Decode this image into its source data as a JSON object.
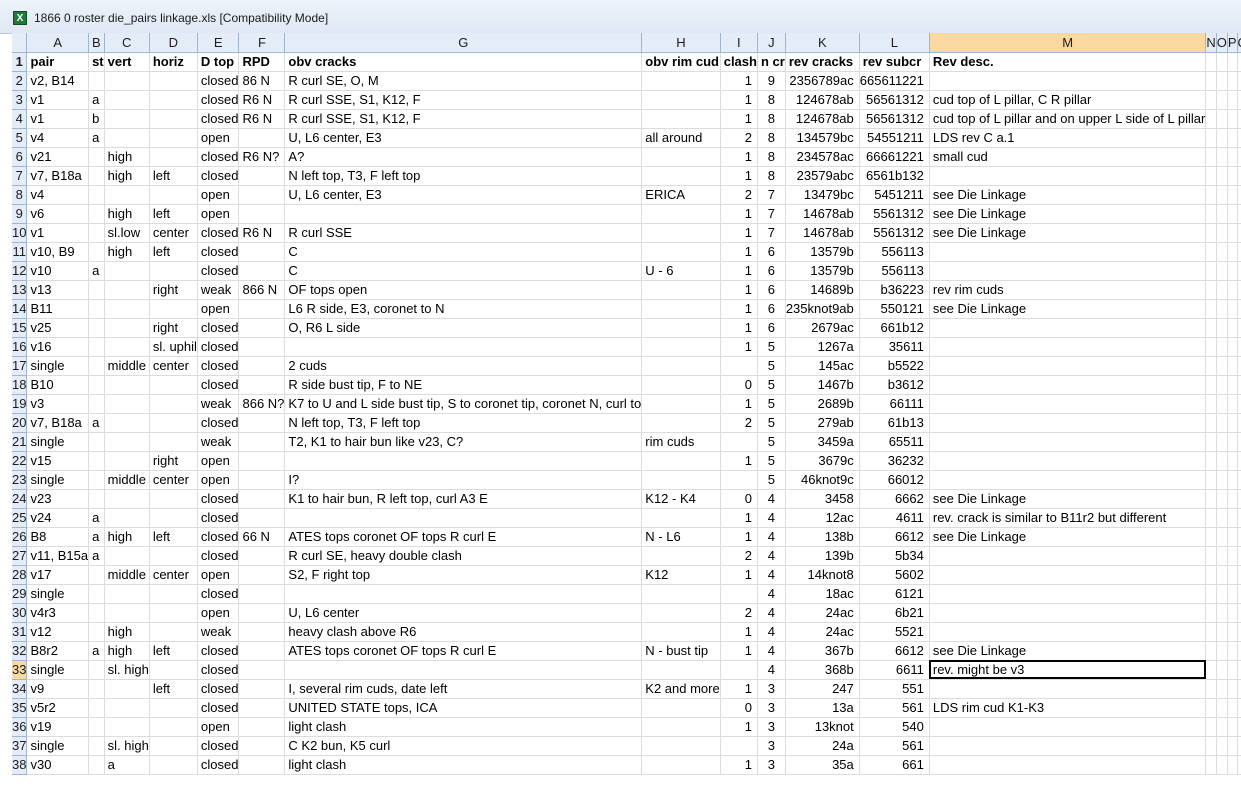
{
  "window": {
    "icon": "excel-file-icon",
    "title": "1866 0 roster die_pairs linkage.xls  [Compatibility Mode]"
  },
  "column_letters": [
    "A",
    "B",
    "C",
    "D",
    "E",
    "F",
    "G",
    "H",
    "I",
    "J",
    "K",
    "L",
    "M",
    "N",
    "O",
    "P",
    "Q"
  ],
  "selected_column": "M",
  "selected_row": "33",
  "active_cell": "M33",
  "rows": [
    {
      "n": "1",
      "c": [
        "pair",
        "st",
        "vert",
        "horiz",
        "D top",
        "RPD",
        "obv cracks",
        "obv rim cud",
        "clash",
        "n cr",
        "rev cracks",
        "rev subcr",
        "Rev desc.",
        "",
        "",
        "",
        ""
      ]
    },
    {
      "n": "2",
      "c": [
        "v2, B14",
        "",
        "",
        "",
        "closed",
        "86 N",
        "R curl SE, O, M",
        "",
        "1",
        "9",
        "2356789ac",
        "665611221",
        "",
        "",
        "",
        "",
        ""
      ]
    },
    {
      "n": "3",
      "c": [
        "v1",
        "a",
        "",
        "",
        "closed",
        "R6 N",
        "R curl SSE, S1, K12, F",
        "",
        "1",
        "8",
        "124678ab",
        "56561312",
        "cud top of L pillar, C R pillar",
        "",
        "",
        "",
        ""
      ]
    },
    {
      "n": "4",
      "c": [
        "v1",
        "b",
        "",
        "",
        "closed",
        "R6 N",
        "R curl SSE, S1, K12, F",
        "",
        "1",
        "8",
        "124678ab",
        "56561312",
        "cud top of L pillar and on upper L side of L pillar",
        "",
        "",
        "",
        ""
      ]
    },
    {
      "n": "5",
      "c": [
        "v4",
        "a",
        "",
        "",
        "open",
        "",
        "U, L6 center, E3",
        "all around",
        "2",
        "8",
        "134579bc",
        "54551211",
        "LDS rev C a.1",
        "",
        "",
        "",
        ""
      ]
    },
    {
      "n": "6",
      "c": [
        "v21",
        "",
        "high",
        "",
        "closed",
        "R6 N?",
        "A?",
        "",
        "1",
        "8",
        "234578ac",
        "66661221",
        "small cud",
        "",
        "",
        "",
        ""
      ]
    },
    {
      "n": "7",
      "c": [
        "v7, B18a",
        "",
        "high",
        "left",
        "closed",
        "",
        "N left top, T3, F left top",
        "",
        "1",
        "8",
        "23579abc",
        "6561b132",
        "",
        "",
        "",
        "",
        ""
      ]
    },
    {
      "n": "8",
      "c": [
        "v4",
        "",
        "",
        "",
        "open",
        "",
        "U, L6 center, E3",
        "ERICA",
        "2",
        "7",
        "13479bc",
        "5451211",
        "see Die Linkage",
        "",
        "",
        "",
        ""
      ]
    },
    {
      "n": "9",
      "c": [
        "v6",
        "",
        "high",
        "left",
        "open",
        "",
        "",
        "",
        "1",
        "7",
        "14678ab",
        "5561312",
        "see Die Linkage",
        "",
        "",
        "",
        ""
      ]
    },
    {
      "n": "10",
      "c": [
        "v1",
        "",
        "sl.low",
        "center",
        "closed",
        "R6 N",
        "R curl SSE",
        "",
        "1",
        "7",
        "14678ab",
        "5561312",
        "see Die Linkage",
        "",
        "",
        "",
        ""
      ]
    },
    {
      "n": "11",
      "c": [
        "v10, B9",
        "",
        "high",
        "left",
        "closed",
        "",
        "C",
        "",
        "1",
        "6",
        "13579b",
        "556113",
        "",
        "",
        "",
        "",
        ""
      ]
    },
    {
      "n": "12",
      "c": [
        "v10",
        "a",
        "",
        "",
        "closed",
        "",
        "C",
        "U - 6",
        "1",
        "6",
        "13579b",
        "556113",
        "",
        "",
        "",
        "",
        ""
      ]
    },
    {
      "n": "13",
      "c": [
        "v13",
        "",
        "",
        "right",
        "weak",
        "866 N",
        "OF tops open",
        "",
        "1",
        "6",
        "14689b",
        "b36223",
        "rev rim cuds",
        "",
        "",
        "",
        ""
      ]
    },
    {
      "n": "14",
      "c": [
        "B11",
        "",
        "",
        "",
        "open",
        "",
        "L6 R side, E3, coronet to N",
        "",
        "1",
        "6",
        "235knot9ab",
        "550121",
        "see Die Linkage",
        "",
        "",
        "",
        ""
      ]
    },
    {
      "n": "15",
      "c": [
        "v25",
        "",
        "",
        "right",
        "closed",
        "",
        "O, R6 L side",
        "",
        "1",
        "6",
        "2679ac",
        "661b12",
        "",
        "",
        "",
        "",
        ""
      ]
    },
    {
      "n": "16",
      "c": [
        "v16",
        "",
        "",
        "sl. uphil",
        "closed",
        "",
        "",
        "",
        "1",
        "5",
        "1267a",
        "35611",
        "",
        "",
        "",
        "",
        ""
      ]
    },
    {
      "n": "17",
      "c": [
        "single",
        "",
        "middle",
        "center",
        "closed",
        "",
        "2 cuds",
        "",
        "",
        "5",
        "145ac",
        "b5522",
        "",
        "",
        "",
        "",
        ""
      ]
    },
    {
      "n": "18",
      "c": [
        "B10",
        "",
        "",
        "",
        "closed",
        "",
        "R side bust tip, F to NE",
        "",
        "0",
        "5",
        "1467b",
        "b3612",
        "",
        "",
        "",
        "",
        ""
      ]
    },
    {
      "n": "19",
      "c": [
        "v3",
        "",
        "",
        "",
        "weak",
        "866 N?",
        "K7 to U and L side bust tip, S to coronet tip, coronet N, curl to",
        "",
        "1",
        "5",
        "2689b",
        "66111",
        "",
        "",
        "",
        "",
        ""
      ]
    },
    {
      "n": "20",
      "c": [
        "v7, B18a",
        "a",
        "",
        "",
        "closed",
        "",
        "N left top, T3, F left top",
        "",
        "2",
        "5",
        "279ab",
        "61b13",
        "",
        "",
        "",
        "",
        ""
      ]
    },
    {
      "n": "21",
      "c": [
        "single",
        "",
        "",
        "",
        "weak",
        "",
        "T2, K1 to hair bun like v23, C?",
        "rim cuds",
        "",
        "5",
        "3459a",
        "65511",
        "",
        "",
        "",
        "",
        ""
      ]
    },
    {
      "n": "22",
      "c": [
        "v15",
        "",
        "",
        "right",
        "open",
        "",
        "",
        "",
        "1",
        "5",
        "3679c",
        "36232",
        "",
        "",
        "",
        "",
        ""
      ]
    },
    {
      "n": "23",
      "c": [
        "single",
        "",
        "middle",
        "center",
        "open",
        "",
        "I?",
        "",
        "",
        "5",
        "46knot9c",
        "66012",
        "",
        "",
        "",
        "",
        ""
      ]
    },
    {
      "n": "24",
      "c": [
        "v23",
        "",
        "",
        "",
        "closed",
        "",
        "K1 to hair bun, R left top, curl A3 E",
        "K12 - K4",
        "0",
        "4",
        "3458",
        "6662",
        "see Die Linkage",
        "",
        "",
        "",
        ""
      ]
    },
    {
      "n": "25",
      "c": [
        "v24",
        "a",
        "",
        "",
        "closed",
        "",
        "",
        "",
        "1",
        "4",
        "12ac",
        "4611",
        "rev. crack is similar to B11r2 but different",
        "",
        "",
        "",
        ""
      ]
    },
    {
      "n": "26",
      "c": [
        "B8",
        "a",
        "high",
        "left",
        "closed",
        "66 N",
        "ATES tops coronet OF tops R curl E",
        "N - L6",
        "1",
        "4",
        "138b",
        "6612",
        "see Die Linkage",
        "",
        "",
        "",
        ""
      ]
    },
    {
      "n": "27",
      "c": [
        "v11, B15a",
        "a",
        "",
        "",
        "closed",
        "",
        "R curl SE, heavy double clash",
        "",
        "2",
        "4",
        "139b",
        "5b34",
        "",
        "",
        "",
        "",
        ""
      ]
    },
    {
      "n": "28",
      "c": [
        "v17",
        "",
        "middle",
        "center",
        "open",
        "",
        "S2, F right top",
        "K12",
        "1",
        "4",
        "14knot8",
        "5602",
        "",
        "",
        "",
        "",
        ""
      ]
    },
    {
      "n": "29",
      "c": [
        "single",
        "",
        "",
        "",
        "closed",
        "",
        "",
        "",
        "",
        "4",
        "18ac",
        "6121",
        "",
        "",
        "",
        "",
        ""
      ]
    },
    {
      "n": "30",
      "c": [
        "v4r3",
        "",
        "",
        "",
        "open",
        "",
        "U, L6 center",
        "",
        "2",
        "4",
        "24ac",
        "6b21",
        "",
        "",
        "",
        "",
        ""
      ]
    },
    {
      "n": "31",
      "c": [
        "v12",
        "",
        "high",
        "",
        "weak",
        "",
        "heavy clash above R6",
        "",
        "1",
        "4",
        "24ac",
        "5521",
        "",
        "",
        "",
        "",
        ""
      ]
    },
    {
      "n": "32",
      "c": [
        "B8r2",
        "a",
        "high",
        "left",
        "closed",
        "",
        "ATES tops coronet OF tops R curl E",
        "N - bust tip",
        "1",
        "4",
        "367b",
        "6612",
        "see Die Linkage",
        "",
        "",
        "",
        ""
      ]
    },
    {
      "n": "33",
      "c": [
        "single",
        "",
        "sl. high",
        "",
        "closed",
        "",
        "",
        "",
        "",
        "4",
        "368b",
        "6611",
        "rev. might be v3",
        "",
        "",
        "",
        ""
      ]
    },
    {
      "n": "34",
      "c": [
        "v9",
        "",
        "",
        "left",
        "closed",
        "",
        "I, several rim cuds, date left",
        "K2 and more",
        "1",
        "3",
        "247",
        "551",
        "",
        "",
        "",
        "",
        ""
      ]
    },
    {
      "n": "35",
      "c": [
        "v5r2",
        "",
        "",
        "",
        "closed",
        "",
        "UNITED STATE tops, ICA",
        "",
        "0",
        "3",
        "13a",
        "561",
        "LDS rim cud K1-K3",
        "",
        "",
        "",
        ""
      ]
    },
    {
      "n": "36",
      "c": [
        "v19",
        "",
        "",
        "",
        "open",
        "",
        "light clash",
        "",
        "1",
        "3",
        "13knot",
        "540",
        "",
        "",
        "",
        "",
        ""
      ]
    },
    {
      "n": "37",
      "c": [
        "single",
        "",
        "sl. high",
        "",
        "closed",
        "",
        "C K2 bun, K5 curl",
        "",
        "",
        "3",
        "24a",
        "561",
        "",
        "",
        "",
        "",
        ""
      ]
    },
    {
      "n": "38",
      "c": [
        "v30",
        "",
        "a",
        "",
        "closed",
        "",
        "light clash",
        "",
        "1",
        "3",
        "35a",
        "661",
        "",
        "",
        "",
        "",
        ""
      ]
    }
  ]
}
